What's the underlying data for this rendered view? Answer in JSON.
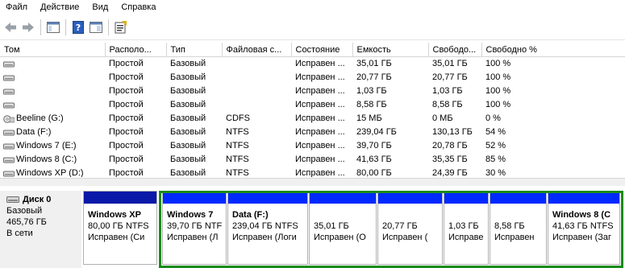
{
  "menu": {
    "file": "Файл",
    "action": "Действие",
    "view": "Вид",
    "help": "Справка"
  },
  "toolbar": {
    "back_icon": "arrow-left-icon",
    "forward_icon": "arrow-right-icon",
    "console_icon": "console-tree-icon",
    "help_icon": "help-icon",
    "panel_icon": "action-pane-icon",
    "properties_icon": "properties-icon"
  },
  "columns": [
    "Том",
    "Располо...",
    "Тип",
    "Файловая с...",
    "Состояние",
    "Емкость",
    "Свободо...",
    "Свободно %"
  ],
  "volumes": [
    {
      "name": "",
      "layout": "Простой",
      "type": "Базовый",
      "fs": "",
      "status": "Исправен ...",
      "capacity": "35,01 ГБ",
      "free": "35,01 ГБ",
      "pct": "100 %"
    },
    {
      "name": "",
      "layout": "Простой",
      "type": "Базовый",
      "fs": "",
      "status": "Исправен ...",
      "capacity": "20,77 ГБ",
      "free": "20,77 ГБ",
      "pct": "100 %"
    },
    {
      "name": "",
      "layout": "Простой",
      "type": "Базовый",
      "fs": "",
      "status": "Исправен ...",
      "capacity": "1,03 ГБ",
      "free": "1,03 ГБ",
      "pct": "100 %"
    },
    {
      "name": "",
      "layout": "Простой",
      "type": "Базовый",
      "fs": "",
      "status": "Исправен ...",
      "capacity": "8,58 ГБ",
      "free": "8,58 ГБ",
      "pct": "100 %"
    },
    {
      "name": "Beeline (G:)",
      "layout": "Простой",
      "type": "Базовый",
      "fs": "CDFS",
      "status": "Исправен ...",
      "capacity": "15 МБ",
      "free": "0 МБ",
      "pct": "0 %"
    },
    {
      "name": "Data (F:)",
      "layout": "Простой",
      "type": "Базовый",
      "fs": "NTFS",
      "status": "Исправен ...",
      "capacity": "239,04 ГБ",
      "free": "130,13 ГБ",
      "pct": "54 %"
    },
    {
      "name": "Windows 7 (E:)",
      "layout": "Простой",
      "type": "Базовый",
      "fs": "NTFS",
      "status": "Исправен ...",
      "capacity": "39,70 ГБ",
      "free": "20,78 ГБ",
      "pct": "52 %"
    },
    {
      "name": "Windows 8 (C:)",
      "layout": "Простой",
      "type": "Базовый",
      "fs": "NTFS",
      "status": "Исправен ...",
      "capacity": "41,63 ГБ",
      "free": "35,35 ГБ",
      "pct": "85 %"
    },
    {
      "name": "Windows XP (D:)",
      "layout": "Простой",
      "type": "Базовый",
      "fs": "NTFS",
      "status": "Исправен ...",
      "capacity": "80,00 ГБ",
      "free": "24,39 ГБ",
      "pct": "30 %"
    }
  ],
  "disk": {
    "title": "Диск 0",
    "type": "Базовый",
    "size": "465,76 ГБ",
    "state": "В сети"
  },
  "partitions": [
    {
      "name": "Windows XP",
      "line2": "80,00 ГБ NTFS",
      "line3": "Исправен (Си",
      "kind": "logical"
    },
    {
      "name": "Windows 7",
      "line2": "39,70 ГБ NTF",
      "line3": "Исправен (Л",
      "kind": "logical"
    },
    {
      "name": "Data  (F:)",
      "line2": "239,04 ГБ NTFS",
      "line3": "Исправен (Логи",
      "kind": "logical"
    },
    {
      "name": "",
      "line2": "35,01 ГБ",
      "line3": "Исправен (О",
      "kind": "logical"
    },
    {
      "name": "",
      "line2": "20,77 ГБ",
      "line3": "Исправен (",
      "kind": "logical"
    },
    {
      "name": "",
      "line2": "1,03 ГБ",
      "line3": "Исправе",
      "kind": "logical"
    },
    {
      "name": "",
      "line2": "8,58 ГБ",
      "line3": "Исправен",
      "kind": "logical"
    },
    {
      "name": "Windows 8  (C",
      "line2": "41,63 ГБ NTFS",
      "line3": "Исправен (Заг",
      "kind": "logical"
    }
  ],
  "colors": {
    "logical_cap": "#0029ff",
    "primary_cap": "#0a19a8",
    "extended_border": "#1a8c1a"
  }
}
